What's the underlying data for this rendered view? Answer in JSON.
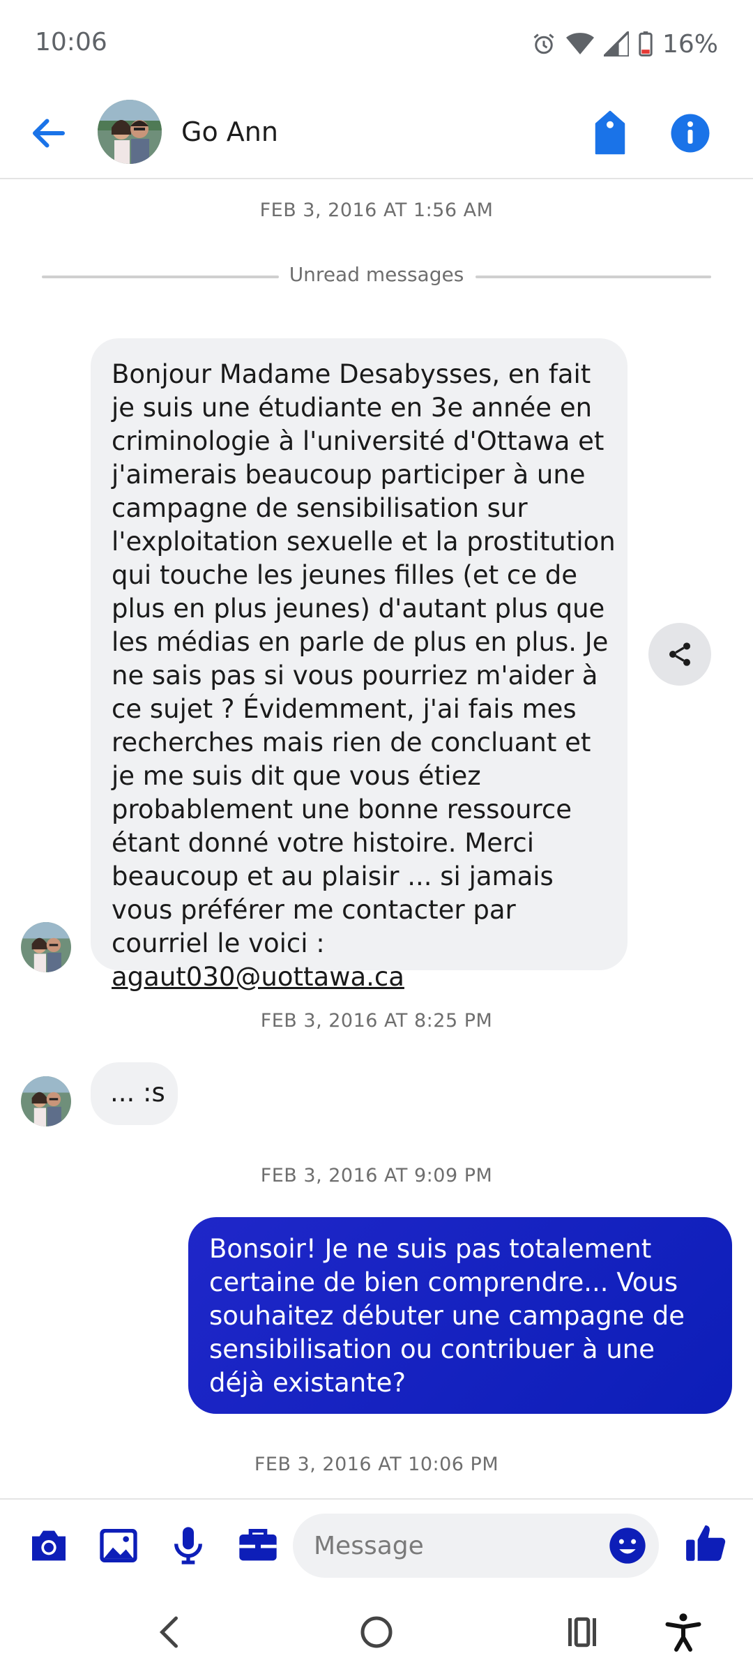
{
  "status_bar": {
    "time": "10:06",
    "battery": "16%",
    "icons": [
      "alarm-icon",
      "wifi-icon",
      "signal-icon",
      "battery-icon"
    ]
  },
  "header": {
    "contact_name": "Go Ann",
    "back_icon": "arrow-left-icon",
    "actions": [
      "tag-icon",
      "info-icon"
    ],
    "accent_color": "#1a73e8"
  },
  "conversation": {
    "timestamp_1": "FEB 3, 2016 AT 1:56 AM",
    "unread_label": "Unread messages",
    "message_1": {
      "text": "Bonjour Madame Desabysses, en fait je suis une étudiante en 3e année en criminologie à l'université d'Ottawa et j'aimerais beaucoup participer à une campagne de sensibilisation sur l'exploitation sexuelle et la prostitution qui touche les jeunes filles (et ce de plus en plus jeunes) d'autant plus que les médias en parle de plus en plus. Je ne sais pas si vous pourriez m'aider à ce sujet ? Évidemment, j'ai fais mes recherches mais rien de concluant et je me suis dit que vous étiez probablement une bonne ressource étant donné votre histoire. Merci beaucoup et au plaisir ... si  jamais vous préférer me contacter par courriel le voici : ",
      "email": "agaut030@uottawa.ca"
    },
    "timestamp_2": "FEB 3, 2016 AT 8:25 PM",
    "message_2": {
      "text": "... :s"
    },
    "timestamp_3": "FEB 3, 2016 AT 9:09 PM",
    "message_3": {
      "text": "Bonsoir! Je ne suis pas totalement certaine de bien comprendre... Vous souhaitez débuter une campagne de sensibilisation ou contribuer à une déjà existante?"
    },
    "timestamp_4": "FEB 3, 2016 AT 10:06 PM",
    "outgoing_color": "#1522c4"
  },
  "composer": {
    "placeholder": "Message",
    "icons": [
      "camera-icon",
      "image-icon",
      "microphone-icon",
      "briefcase-icon",
      "emoji-icon",
      "thumbs-up-icon"
    ]
  },
  "nav_bar": {
    "icons": [
      "nav-back-icon",
      "nav-home-icon",
      "nav-recents-icon",
      "accessibility-icon"
    ]
  }
}
